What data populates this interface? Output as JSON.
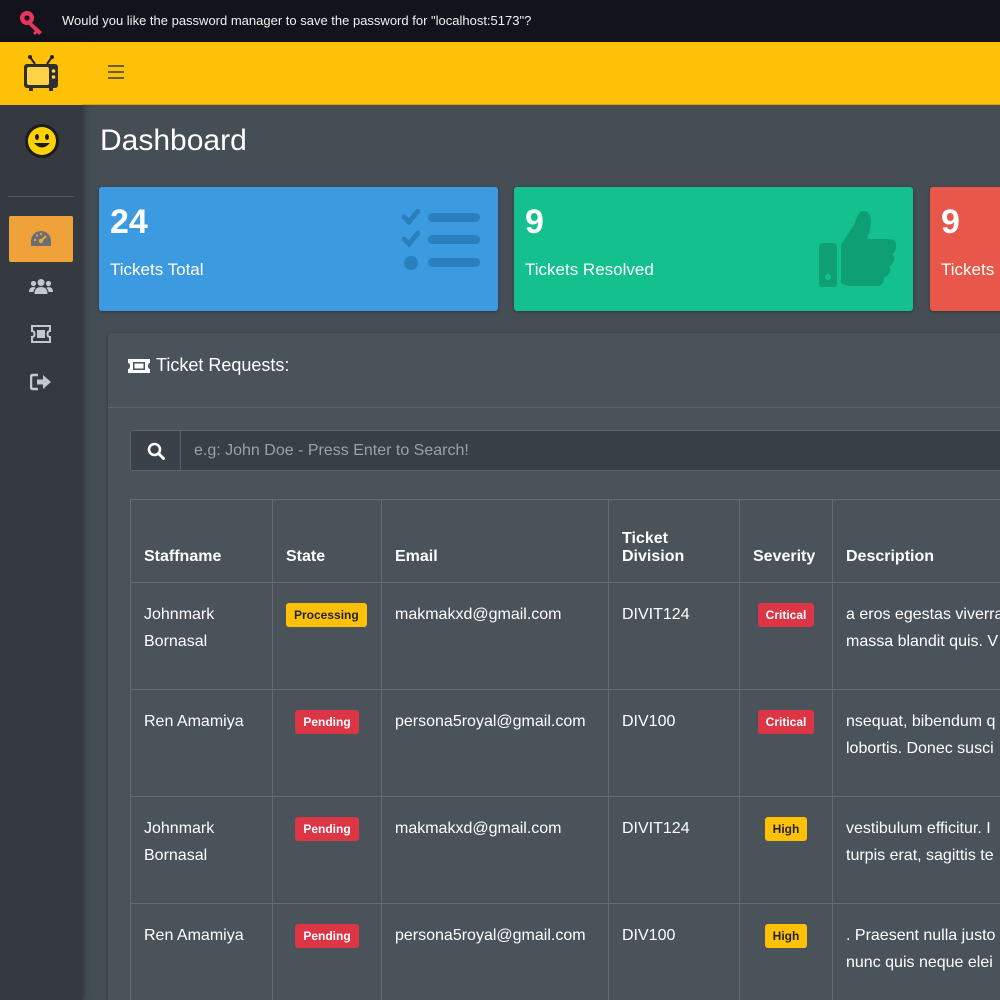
{
  "password_bar": {
    "message": "Would you like the password manager to save the password for \"localhost:5173\"?"
  },
  "sidebar": {
    "items": [
      {
        "name": "dashboard",
        "icon": "tachometer-icon",
        "active": true
      },
      {
        "name": "users",
        "icon": "users-icon",
        "active": false
      },
      {
        "name": "tickets",
        "icon": "ticket-admin-icon",
        "active": false
      },
      {
        "name": "logout",
        "icon": "sign-out-icon",
        "active": false
      }
    ]
  },
  "page": {
    "title": "Dashboard"
  },
  "stats": [
    {
      "value": "24",
      "label": "Tickets Total",
      "color": "#3c9be0",
      "icon": "list-check-icon"
    },
    {
      "value": "9",
      "label": "Tickets Resolved",
      "color": "#13c08e",
      "icon": "thumbs-up-icon"
    },
    {
      "value": "9",
      "label": "Tickets I",
      "color": "#e9574a",
      "icon": ""
    }
  ],
  "card": {
    "title": "Ticket Requests:"
  },
  "search": {
    "placeholder": "e.g: John Doe - Press Enter to Search!"
  },
  "table": {
    "headers": {
      "staffname": "Staffname",
      "state": "State",
      "email": "Email",
      "division": "Ticket Division",
      "severity": "Severity",
      "description": "Description"
    },
    "rows": [
      {
        "staffname": "Johnmark Bornasal",
        "state": "Processing",
        "email": "makmakxd@gmail.com",
        "division": "DIVIT124",
        "severity": "Critical",
        "description_1": "a eros egestas viverra",
        "description_2": "massa blandit quis. V"
      },
      {
        "staffname": "Ren Amamiya",
        "state": "Pending",
        "email": "persona5royal@gmail.com",
        "division": "DIV100",
        "severity": "Critical",
        "description_1": "nsequat, bibendum q",
        "description_2": "lobortis. Donec susci"
      },
      {
        "staffname": "Johnmark Bornasal",
        "state": "Pending",
        "email": "makmakxd@gmail.com",
        "division": "DIVIT124",
        "severity": "High",
        "description_1": "vestibulum efficitur. I",
        "description_2": "turpis erat, sagittis te"
      },
      {
        "staffname": "Ren Amamiya",
        "state": "Pending",
        "email": "persona5royal@gmail.com",
        "division": "DIV100",
        "severity": "High",
        "description_1": ". Praesent nulla justo",
        "description_2": "nunc quis neque elei"
      }
    ]
  },
  "colors": {
    "brand": "#ffc107",
    "sidebar": "#343a40",
    "active_nav": "#f0a23a",
    "content_bg": "#454d55",
    "badge_warning": "#ffc107",
    "badge_danger": "#dc3545"
  }
}
